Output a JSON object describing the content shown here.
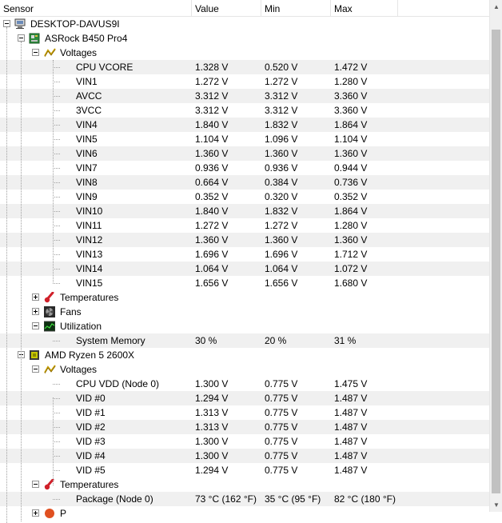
{
  "header": {
    "sensor": "Sensor",
    "value": "Value",
    "min": "Min",
    "max": "Max"
  },
  "tree": {
    "computer": {
      "label": "DESKTOP-DAVUS9I",
      "icon": "computer-icon"
    },
    "board": {
      "label": "ASRock B450 Pro4",
      "icon": "motherboard-icon",
      "voltages_label": "Voltages",
      "voltages": [
        {
          "name": "CPU VCORE",
          "value": "1.328 V",
          "min": "0.520 V",
          "max": "1.472 V"
        },
        {
          "name": "VIN1",
          "value": "1.272 V",
          "min": "1.272 V",
          "max": "1.280 V"
        },
        {
          "name": "AVCC",
          "value": "3.312 V",
          "min": "3.312 V",
          "max": "3.360 V"
        },
        {
          "name": "3VCC",
          "value": "3.312 V",
          "min": "3.312 V",
          "max": "3.360 V"
        },
        {
          "name": "VIN4",
          "value": "1.840 V",
          "min": "1.832 V",
          "max": "1.864 V"
        },
        {
          "name": "VIN5",
          "value": "1.104 V",
          "min": "1.096 V",
          "max": "1.104 V"
        },
        {
          "name": "VIN6",
          "value": "1.360 V",
          "min": "1.360 V",
          "max": "1.360 V"
        },
        {
          "name": "VIN7",
          "value": "0.936 V",
          "min": "0.936 V",
          "max": "0.944 V"
        },
        {
          "name": "VIN8",
          "value": "0.664 V",
          "min": "0.384 V",
          "max": "0.736 V"
        },
        {
          "name": "VIN9",
          "value": "0.352 V",
          "min": "0.320 V",
          "max": "0.352 V"
        },
        {
          "name": "VIN10",
          "value": "1.840 V",
          "min": "1.832 V",
          "max": "1.864 V"
        },
        {
          "name": "VIN11",
          "value": "1.272 V",
          "min": "1.272 V",
          "max": "1.280 V"
        },
        {
          "name": "VIN12",
          "value": "1.360 V",
          "min": "1.360 V",
          "max": "1.360 V"
        },
        {
          "name": "VIN13",
          "value": "1.696 V",
          "min": "1.696 V",
          "max": "1.712 V"
        },
        {
          "name": "VIN14",
          "value": "1.064 V",
          "min": "1.064 V",
          "max": "1.072 V"
        },
        {
          "name": "VIN15",
          "value": "1.656 V",
          "min": "1.656 V",
          "max": "1.680 V"
        }
      ],
      "temperatures_label": "Temperatures",
      "fans_label": "Fans",
      "utilization_label": "Utilization",
      "utilization": [
        {
          "name": "System Memory",
          "value": "30 %",
          "min": "20 %",
          "max": "31 %"
        }
      ]
    },
    "cpu": {
      "label": "AMD Ryzen 5 2600X",
      "icon": "cpu-chip-icon",
      "voltages_label": "Voltages",
      "voltages": [
        {
          "name": "CPU VDD (Node 0)",
          "value": "1.300 V",
          "min": "0.775 V",
          "max": "1.475 V"
        },
        {
          "name": "VID #0",
          "value": "1.294 V",
          "min": "0.775 V",
          "max": "1.487 V"
        },
        {
          "name": "VID #1",
          "value": "1.313 V",
          "min": "0.775 V",
          "max": "1.487 V"
        },
        {
          "name": "VID #2",
          "value": "1.313 V",
          "min": "0.775 V",
          "max": "1.487 V"
        },
        {
          "name": "VID #3",
          "value": "1.300 V",
          "min": "0.775 V",
          "max": "1.487 V"
        },
        {
          "name": "VID #4",
          "value": "1.300 V",
          "min": "0.775 V",
          "max": "1.487 V"
        },
        {
          "name": "VID #5",
          "value": "1.294 V",
          "min": "0.775 V",
          "max": "1.487 V"
        }
      ],
      "temperatures_label": "Temperatures",
      "temperatures": [
        {
          "name": "Package (Node 0)",
          "value": "73 °C  (162 °F)",
          "min": "35 °C  (95 °F)",
          "max": "82 °C  (180 °F)"
        }
      ],
      "next_label": "P"
    }
  },
  "colors": {
    "alt_row": "#f0f0f0",
    "voltage_icon": "#c8a000",
    "temperature_icon": "#d0202a",
    "chip_icon": "#c8c800"
  }
}
